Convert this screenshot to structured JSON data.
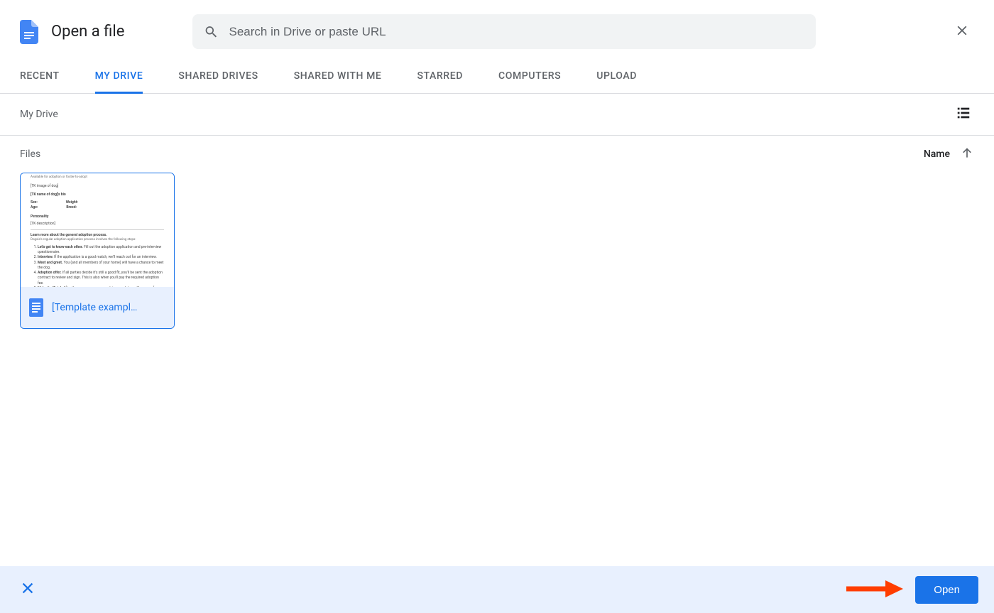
{
  "header": {
    "title": "Open a file",
    "search_placeholder": "Search in Drive or paste URL"
  },
  "tabs": [
    {
      "label": "RECENT",
      "active": false
    },
    {
      "label": "MY DRIVE",
      "active": true
    },
    {
      "label": "SHARED DRIVES",
      "active": false
    },
    {
      "label": "SHARED WITH ME",
      "active": false
    },
    {
      "label": "STARRED",
      "active": false
    },
    {
      "label": "COMPUTERS",
      "active": false
    },
    {
      "label": "UPLOAD",
      "active": false
    }
  ],
  "breadcrumb": "My Drive",
  "files_section_label": "Files",
  "sort": {
    "by": "Name",
    "direction": "asc"
  },
  "files": [
    {
      "name": "[Template exampl…",
      "type": "doc",
      "selected": true,
      "preview": {
        "line1": "Available for adoption or foster-to-adopt",
        "line2": "[TK image of dog]",
        "line3": "[TK name of dog]'s bio",
        "stat1a": "Sex:",
        "stat1b": "Weight:",
        "stat2a": "Age:",
        "stat2b": "Breed:",
        "line4": "Personality",
        "line5": "[TK description]",
        "line6": "Learn more about the general adoption process.",
        "line7": "Dogsie's regular adoption application process involves the following steps:",
        "li1": "Let's get to know each other. Fill out the adoption application and pre-interview questionnaire.",
        "li2": "Interview. If the application is a good match, we'll reach out for an interview.",
        "li3": "Meet and greet. You (and all members of your home) will have a chance to meet the dog.",
        "li4": "Adoption offer. If all parties decide it's still a good fit, you'll be sent the adoption contract to review and sign. This is also when you'll pay the required adoption fee.",
        "li5": "Make it official. After the necessary paperwork is complete, we'll arrange for you and the foster family to meet, so you can bring your new pup home!"
      }
    }
  ],
  "actions": {
    "open_label": "Open"
  }
}
